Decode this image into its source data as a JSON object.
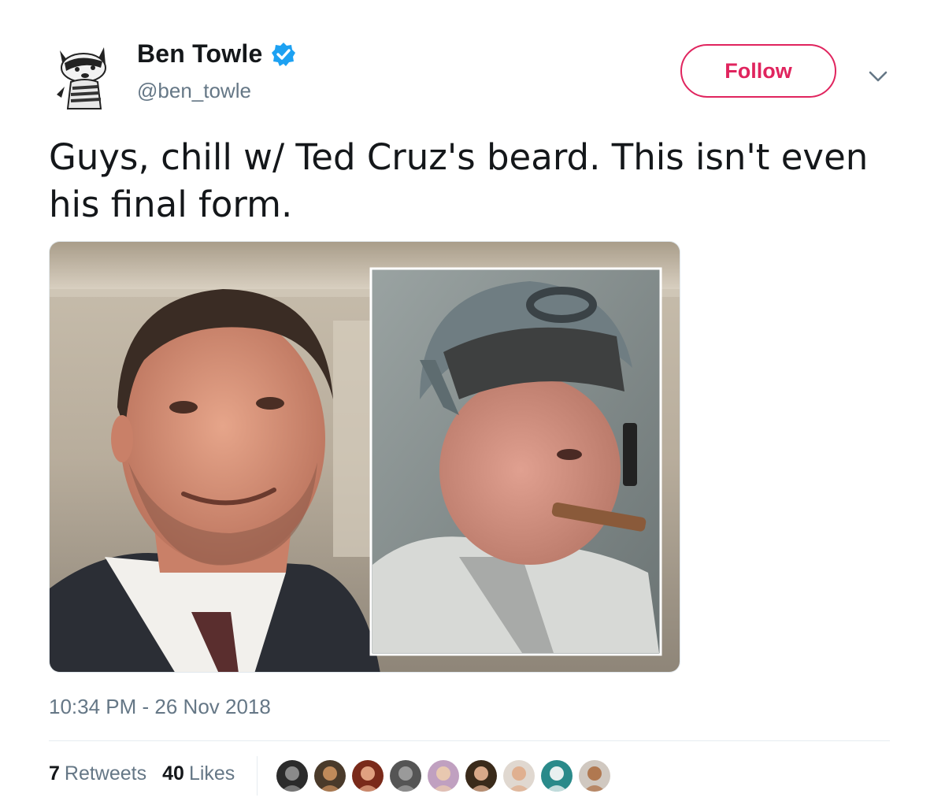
{
  "user": {
    "display_name": "Ben Towle",
    "handle": "@ben_towle",
    "verified": true,
    "avatar_icon": "badger-avatar-icon"
  },
  "actions": {
    "follow_label": "Follow",
    "menu_icon": "chevron-down-icon"
  },
  "tweet": {
    "text": "Guys, chill w/ Ted Cruz's beard. This isn't even his final form.",
    "timestamp": "10:34 PM - 26 Nov 2018"
  },
  "stats": {
    "retweets_count": "7",
    "retweets_label": "Retweets",
    "likes_count": "40",
    "likes_label": "Likes"
  },
  "likers": [
    {
      "color": "#2b2b2b",
      "skin": "#8a8a8a"
    },
    {
      "color": "#4a3a2a",
      "skin": "#c08a5a"
    },
    {
      "color": "#7a2a1a",
      "skin": "#e0a080"
    },
    {
      "color": "#555555",
      "skin": "#9a9a9a"
    },
    {
      "color": "#c0a0c0",
      "skin": "#e8c8b0"
    },
    {
      "color": "#3a2a1a",
      "skin": "#d8a888"
    },
    {
      "color": "#e0d8d0",
      "skin": "#e0b090"
    },
    {
      "color": "#2a8a8a",
      "skin": "#e8f0f0"
    },
    {
      "color": "#d0c8c0",
      "skin": "#b07850"
    }
  ],
  "colors": {
    "accent": "#e0245e",
    "verified": "#1da1f2",
    "secondary_text": "#657786"
  }
}
